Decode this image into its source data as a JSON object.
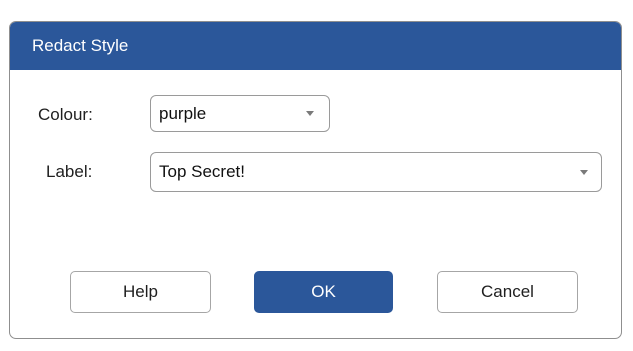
{
  "dialog": {
    "title": "Redact Style"
  },
  "colour": {
    "label": "Colour:",
    "selected": "purple",
    "arrow_icon": "dropdown-arrow"
  },
  "label_field": {
    "label": "Label:",
    "selected": "Top Secret!",
    "arrow_icon": "dropdown-arrow"
  },
  "buttons": {
    "help": "Help",
    "ok": "OK",
    "cancel": "Cancel"
  },
  "colors": {
    "accent": "#2b579a",
    "border": "#9a9a9a"
  }
}
